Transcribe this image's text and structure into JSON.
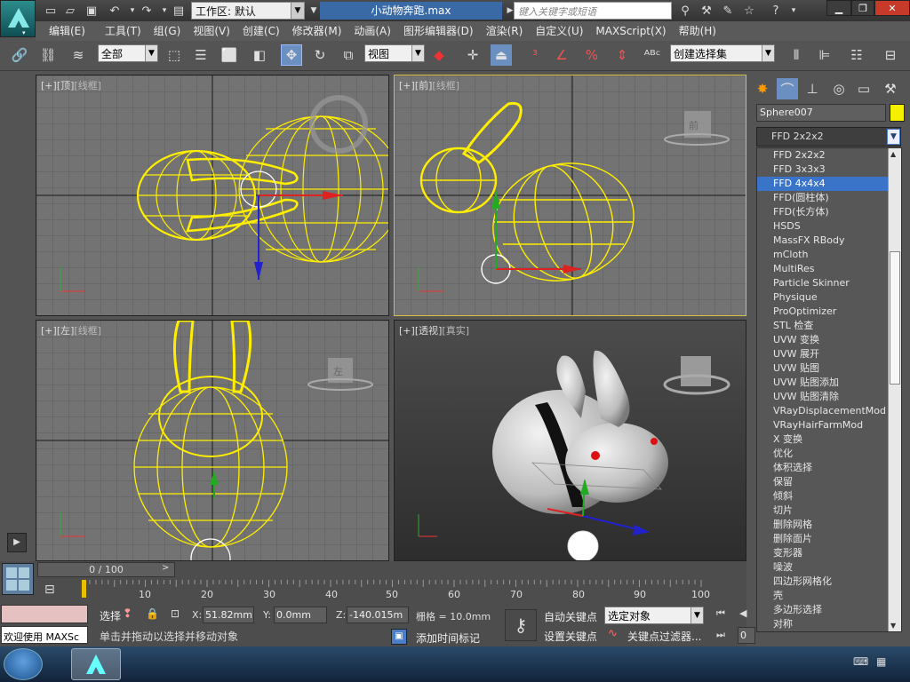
{
  "title_bar": {
    "workspace": "工作区: 默认",
    "filename": "小动物奔跑.max",
    "search_placeholder": "键入关键字或短语"
  },
  "menu": [
    "编辑(E)",
    "工具(T)",
    "组(G)",
    "视图(V)",
    "创建(C)",
    "修改器(M)",
    "动画(A)",
    "图形编辑器(D)",
    "渲染(R)",
    "自定义(U)",
    "MAXScript(X)",
    "帮助(H)"
  ],
  "toolbar": {
    "selection_filter": "全部",
    "reference_coord": "视图",
    "named_selection": "创建选择集"
  },
  "viewports": {
    "top": {
      "a": "[+]",
      "b": "[顶]",
      "c": "[线框]"
    },
    "front": {
      "a": "[+]",
      "b": "[前]",
      "c": "[线框]"
    },
    "left": {
      "a": "[+]",
      "b": "[左]",
      "c": "[线框]"
    },
    "persp": {
      "a": "[+]",
      "b": "[透视]",
      "c": "[真实]"
    },
    "viewcube_front": "前",
    "viewcube_left": "左"
  },
  "command_panel": {
    "object_name": "Sphere007",
    "object_color": "#f5f000",
    "modifier_selected": "FFD 2x2x2",
    "modifiers": [
      "FFD 2x2x2",
      "FFD 3x3x3",
      "FFD 4x4x4",
      "FFD(圆柱体)",
      "FFD(长方体)",
      "HSDS",
      "MassFX RBody",
      "mCloth",
      "MultiRes",
      "Particle Skinner",
      "Physique",
      "ProOptimizer",
      "STL 检查",
      "UVW 变换",
      "UVW 展开",
      "UVW 贴图",
      "UVW 贴图添加",
      "UVW 贴图清除",
      "VRayDisplacementMod",
      "VRayHairFarmMod",
      "X 变换",
      "优化",
      "体积选择",
      "保留",
      "倾斜",
      "切片",
      "删除网格",
      "删除面片",
      "变形器",
      "噪波",
      "四边形网格化",
      "壳",
      "多边形选择",
      "对称"
    ],
    "highlighted_index": 2
  },
  "timeline": {
    "frame_display": "0 / 100",
    "ticks": [
      "10",
      "20",
      "30",
      "40",
      "50",
      "60",
      "70",
      "80",
      "90",
      "100"
    ]
  },
  "status": {
    "select_label": "选择",
    "x_label": "X:",
    "x_value": "51.82mm",
    "y_label": "Y:",
    "y_value": "0.0mm",
    "z_label": "Z:",
    "z_value": "-140.015m",
    "grid": "栅格 = 10.0mm",
    "welcome": "欢迎使用 MAXSc",
    "message": "单击并拖动以选择并移动对象",
    "add_time_tag": "添加时间标记",
    "auto_key": "自动关键点",
    "set_key": "设置关键点",
    "key_filter_select": "选定对象",
    "key_filters": "关键点过滤器...",
    "current_frame": "0"
  },
  "colors": {
    "wire": "#ffee00",
    "grid": "#5a5a5a",
    "selection": "#3a74c8"
  }
}
